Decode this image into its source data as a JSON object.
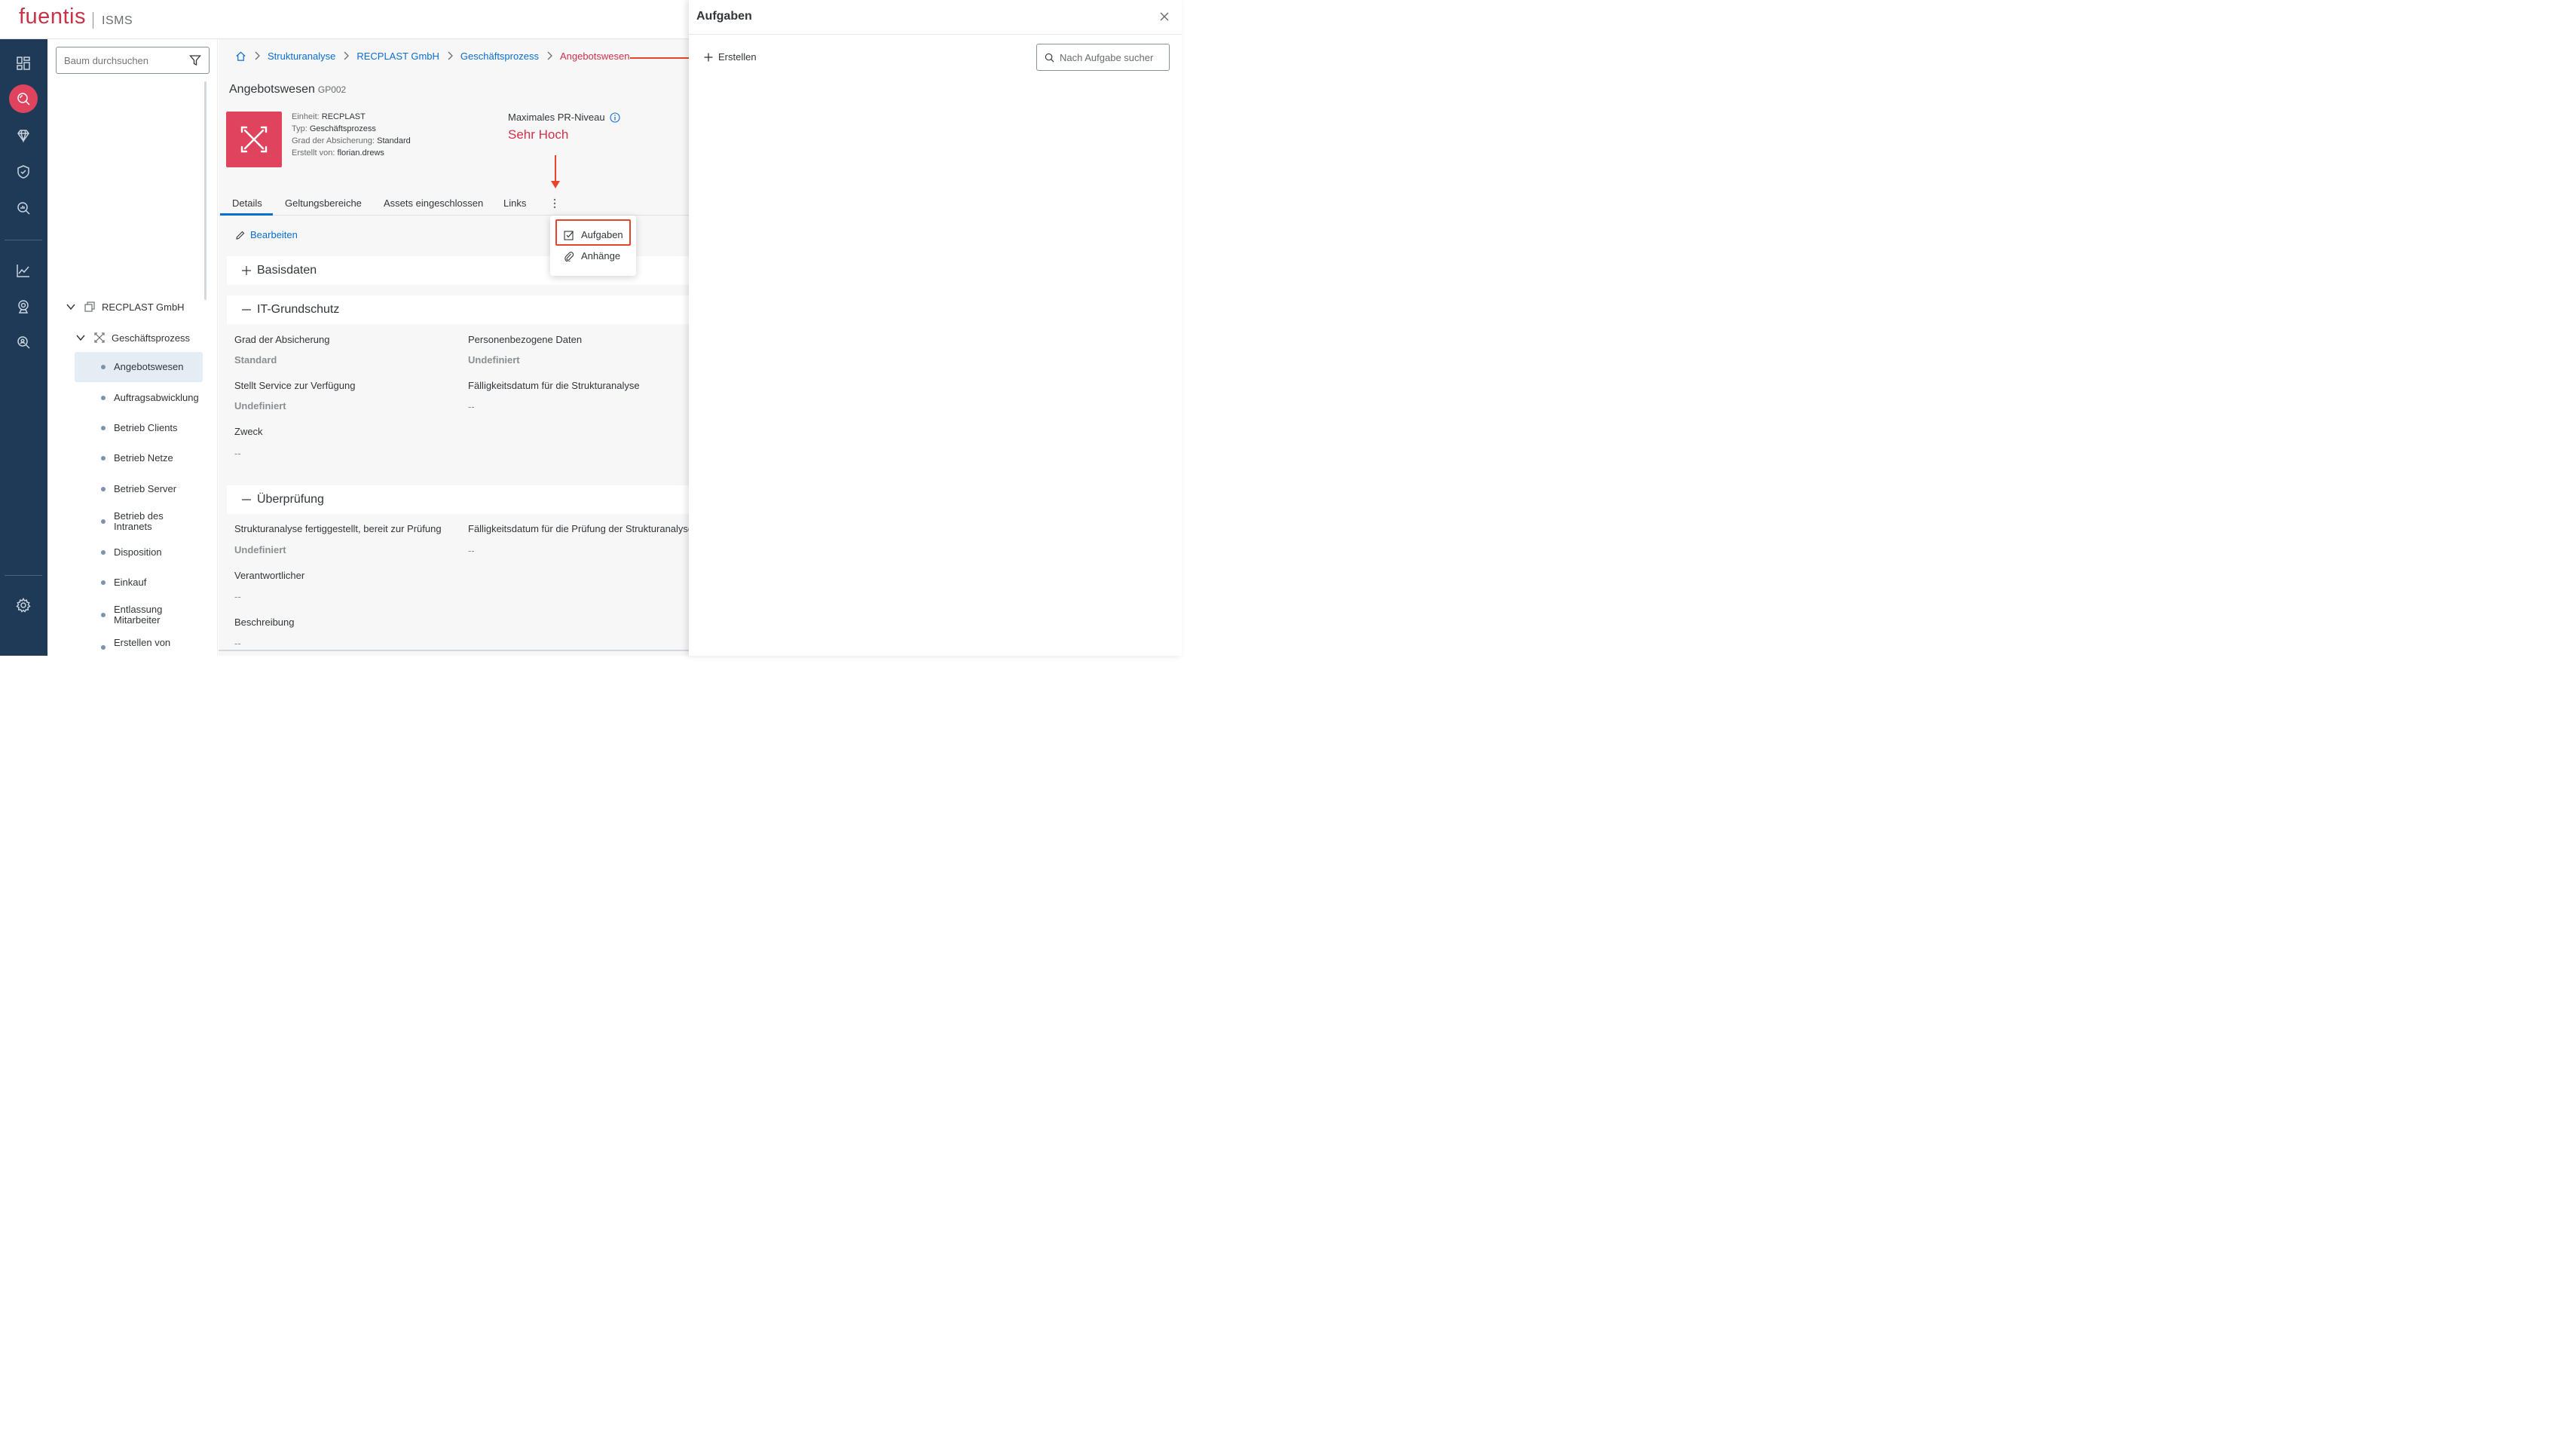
{
  "app": {
    "brand": "fuentis",
    "product": "ISMS"
  },
  "colors": {
    "brand": "#c7344a",
    "rail": "#1f3a57",
    "accent": "#0a6ed1",
    "danger": "#d0304a",
    "annotation": "#e8442c"
  },
  "rail": {
    "items": [
      {
        "icon": "dashboard-icon"
      },
      {
        "icon": "search-analysis-icon",
        "active": true
      },
      {
        "icon": "diamond-icon"
      },
      {
        "icon": "shield-check-icon"
      },
      {
        "icon": "search-chart-icon"
      },
      {
        "icon": "line-chart-icon"
      },
      {
        "icon": "webcam-icon"
      },
      {
        "icon": "search-person-icon"
      },
      {
        "icon": "settings-gear-icon"
      }
    ]
  },
  "tree": {
    "search_placeholder": "Baum durchsuchen",
    "root": "RECPLAST GmbH",
    "group": "Geschäftsprozess",
    "leaves": [
      {
        "label": "Angebotswesen",
        "selected": true
      },
      {
        "label": "Auftragsabwicklung"
      },
      {
        "label": "Betrieb Clients"
      },
      {
        "label": "Betrieb Netze"
      },
      {
        "label": "Betrieb Server"
      },
      {
        "label": "Betrieb des Intranets"
      },
      {
        "label": "Disposition"
      },
      {
        "label": "Einkauf"
      },
      {
        "label": "Entlassung Mitarbeiter"
      },
      {
        "label": "Erstellen von"
      }
    ]
  },
  "breadcrumb": {
    "items": [
      "Strukturanalyse",
      "RECPLAST GmbH",
      "Geschäftsprozess",
      "Angebotswesen"
    ]
  },
  "object": {
    "title": "Angebotswesen",
    "id": "GP002",
    "meta": {
      "unit_label": "Einheit:",
      "unit": "RECPLAST",
      "type_label": "Typ:",
      "type": "Geschäftsprozess",
      "grade_label": "Grad der Absicherung:",
      "grade": "Standard",
      "created_label": "Erstellt von:",
      "created_by": "florian.drews"
    },
    "pr_level_label": "Maximales PR-Niveau",
    "pr_level_value": "Sehr Hoch"
  },
  "tabs": [
    "Details",
    "Geltungsbereiche",
    "Assets eingeschlossen",
    "Links"
  ],
  "edit_label": "Bearbeiten",
  "sections": {
    "basisdaten": "Basisdaten",
    "grundschutz": {
      "title": "IT-Grundschutz",
      "f1_label": "Grad der Absicherung",
      "f1_value": "Standard",
      "f2_label": "Personenbezogene Daten",
      "f2_value": "Undefiniert",
      "f3_label": "Stellt Service zur Verfügung",
      "f3_value": "Undefiniert",
      "f4_label": "Fälligkeitsdatum für die Strukturanalyse",
      "f4_value": "--",
      "f5_label": "Zweck",
      "f5_value": "--"
    },
    "pruefung": {
      "title": "Überprüfung",
      "f1_label": "Strukturanalyse fertiggestellt, bereit zur Prüfung",
      "f1_value": "Undefiniert",
      "f2_label": "Fälligkeitsdatum für die Prüfung der Strukturanalyse",
      "f2_value": "--",
      "f3_label": "Verantwortlicher",
      "f3_value": "--",
      "f4_label": "Beschreibung",
      "f4_value": "--"
    }
  },
  "popover": {
    "item1": "Aufgaben",
    "item2": "Anhänge"
  },
  "panel": {
    "title": "Aufgaben",
    "create_label": "Erstellen",
    "search_placeholder": "Nach Aufgabe sucher"
  }
}
